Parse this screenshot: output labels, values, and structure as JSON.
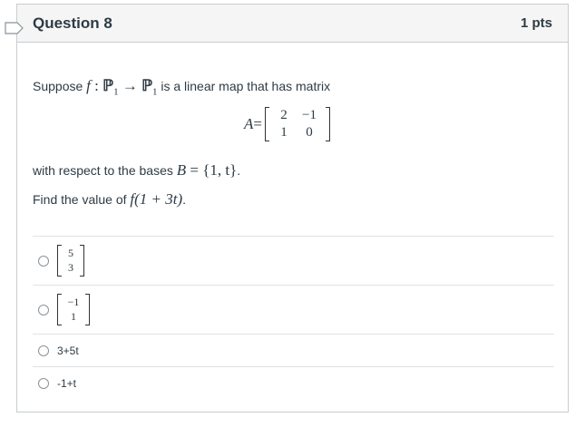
{
  "question": {
    "title": "Question 8",
    "points": "1 pts",
    "stem_prefix": "Suppose",
    "map_f": "f",
    "map_colon": " : ",
    "space_P": "ℙ",
    "space_sub": "1",
    "arrow": " → ",
    "stem_suffix": "is a linear map that has matrix",
    "matrix_label": "A",
    "equals": " = ",
    "matrix": [
      [
        "2",
        "−1"
      ],
      [
        "1",
        "0"
      ]
    ],
    "bases_prefix": "with respect to the bases",
    "basis_name": "B",
    "basis_set": " = {1, t}",
    "bases_end": ".",
    "find_prefix": "Find the value of",
    "find_expr": "f(1 + 3t)",
    "find_end": "."
  },
  "answers": [
    {
      "type": "vector",
      "values": [
        "5",
        "3"
      ]
    },
    {
      "type": "vector",
      "values": [
        "−1",
        "1"
      ]
    },
    {
      "type": "text",
      "label": "3+5t"
    },
    {
      "type": "text",
      "label": "-1+t"
    }
  ]
}
